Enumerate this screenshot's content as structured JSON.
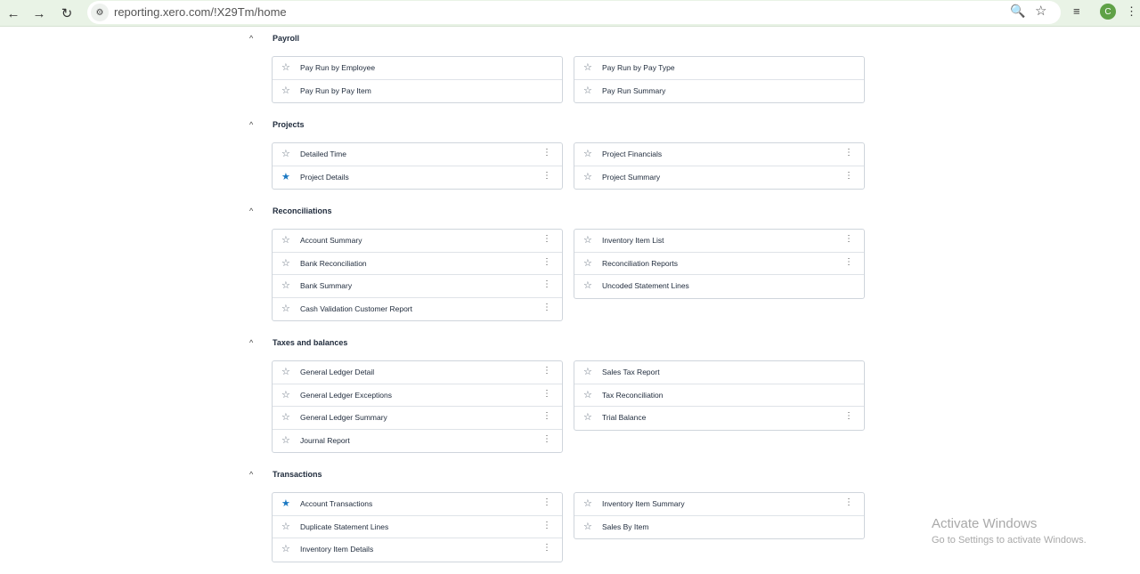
{
  "browser": {
    "url": "reporting.xero.com/!X29Tm/home",
    "profile_initial": "C",
    "icons": [
      "back-icon",
      "forward-icon",
      "reload-icon",
      "site-info-icon",
      "zoom-icon",
      "bookmark-star-icon",
      "media-control-icon",
      "kebab-menu-icon"
    ]
  },
  "colors": {
    "favorite_star": "#1a78c2",
    "browser_bar": "#e9f3e6",
    "avatar": "#5fa146"
  },
  "sections": [
    {
      "title": "Payroll",
      "left": [
        {
          "label": "Pay Run by Employee",
          "favorite": false,
          "menu": false
        },
        {
          "label": "Pay Run by Pay Item",
          "favorite": false,
          "menu": false
        }
      ],
      "right": [
        {
          "label": "Pay Run by Pay Type",
          "favorite": false,
          "menu": false
        },
        {
          "label": "Pay Run Summary",
          "favorite": false,
          "menu": false
        }
      ]
    },
    {
      "title": "Projects",
      "left": [
        {
          "label": "Detailed Time",
          "favorite": false,
          "menu": true
        },
        {
          "label": "Project Details",
          "favorite": true,
          "menu": true
        }
      ],
      "right": [
        {
          "label": "Project Financials",
          "favorite": false,
          "menu": true
        },
        {
          "label": "Project Summary",
          "favorite": false,
          "menu": true
        }
      ]
    },
    {
      "title": "Reconciliations",
      "left": [
        {
          "label": "Account Summary",
          "favorite": false,
          "menu": true
        },
        {
          "label": "Bank Reconciliation",
          "favorite": false,
          "menu": true
        },
        {
          "label": "Bank Summary",
          "favorite": false,
          "menu": true
        },
        {
          "label": "Cash Validation Customer Report",
          "favorite": false,
          "menu": true
        }
      ],
      "right": [
        {
          "label": "Inventory Item List",
          "favorite": false,
          "menu": true
        },
        {
          "label": "Reconciliation Reports",
          "favorite": false,
          "menu": true
        },
        {
          "label": "Uncoded Statement Lines",
          "favorite": false,
          "menu": false
        }
      ]
    },
    {
      "title": "Taxes and balances",
      "left": [
        {
          "label": "General Ledger Detail",
          "favorite": false,
          "menu": true
        },
        {
          "label": "General Ledger Exceptions",
          "favorite": false,
          "menu": true
        },
        {
          "label": "General Ledger Summary",
          "favorite": false,
          "menu": true
        },
        {
          "label": "Journal Report",
          "favorite": false,
          "menu": true
        }
      ],
      "right": [
        {
          "label": "Sales Tax Report",
          "favorite": false,
          "menu": false
        },
        {
          "label": "Tax Reconciliation",
          "favorite": false,
          "menu": false
        },
        {
          "label": "Trial Balance",
          "favorite": false,
          "menu": true
        }
      ]
    },
    {
      "title": "Transactions",
      "left": [
        {
          "label": "Account Transactions",
          "favorite": true,
          "menu": true
        },
        {
          "label": "Duplicate Statement Lines",
          "favorite": false,
          "menu": true
        },
        {
          "label": "Inventory Item Details",
          "favorite": false,
          "menu": true
        }
      ],
      "right": [
        {
          "label": "Inventory Item Summary",
          "favorite": false,
          "menu": true
        },
        {
          "label": "Sales By Item",
          "favorite": false,
          "menu": false
        }
      ]
    }
  ],
  "watermark": {
    "title": "Activate Windows",
    "subtitle": "Go to Settings to activate Windows."
  }
}
